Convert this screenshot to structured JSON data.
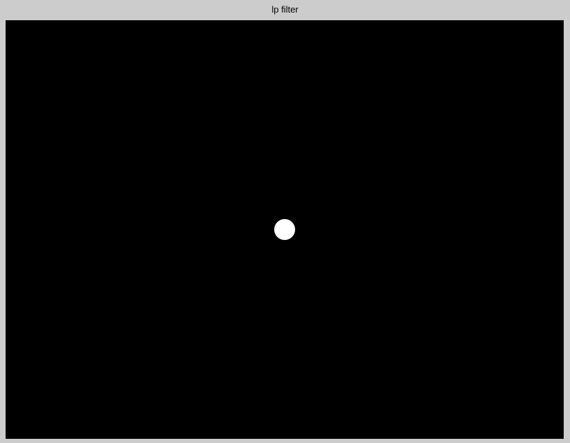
{
  "window": {
    "title": "lp filter"
  },
  "image": {
    "background_color": "#000000",
    "disc_color": "#ffffff"
  }
}
